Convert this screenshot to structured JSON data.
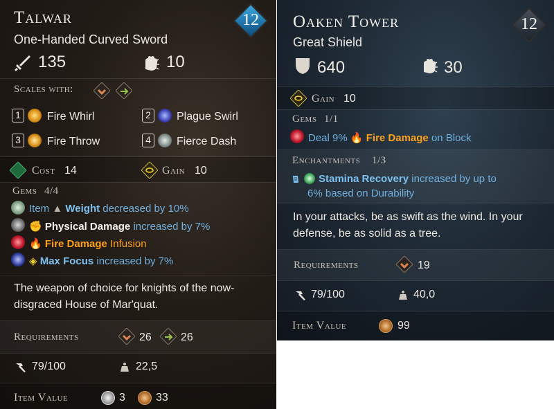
{
  "left": {
    "title": "Talwar",
    "level": "12",
    "subtitle": "One-Handed Curved Sword",
    "damage": "135",
    "stagger": "10",
    "scales_label": "Scales with:",
    "skills": [
      {
        "key": "1",
        "name": "Fire Whirl"
      },
      {
        "key": "2",
        "name": "Plague Swirl"
      },
      {
        "key": "3",
        "name": "Fire Throw"
      },
      {
        "key": "4",
        "name": "Fierce Dash"
      }
    ],
    "cost_label": "Cost",
    "cost_value": "14",
    "gain_label": "Gain",
    "gain_value": "10",
    "gems_label": "Gems",
    "gems_count": "4/4",
    "gems": [
      {
        "pre": "Item",
        "stat": "Weight",
        "post": "decreased by 10%"
      },
      {
        "pre": "",
        "stat": "Physical Damage",
        "post": "increased by 7%"
      },
      {
        "pre": "",
        "stat": "Fire Damage",
        "post": "Infusion"
      },
      {
        "pre": "",
        "stat": "Max Focus",
        "post": "increased by 7%"
      }
    ],
    "description_line1": "The weapon of choice for knights of the now-",
    "description_line2": "disgraced House of Mar'quat.",
    "requirements_label": "Requirements",
    "req_strength": "26",
    "req_agility": "26",
    "durability": "79/100",
    "weight": "22,5",
    "item_value_label": "Item Value",
    "value_silver": "3",
    "value_bronze": "33"
  },
  "right": {
    "title": "Oaken Tower",
    "level": "12",
    "subtitle": "Great Shield",
    "armor": "640",
    "stagger": "30",
    "gain_label": "Gain",
    "gain_value": "10",
    "gems_label": "Gems",
    "gems_count": "1/1",
    "gem_pre": "Deal 9%",
    "gem_stat": "Fire Damage",
    "gem_post": "on Block",
    "enchant_label": "Enchantments",
    "enchant_count": "1/3",
    "enchant_stat": "Stamina Recovery",
    "enchant_post": "increased by up to",
    "enchant_line2": "6% based on Durability",
    "description_line1": "In your attacks, be as swift as the wind. In your",
    "description_line2": "defense, be as solid as a tree.",
    "requirements_label": "Requirements",
    "req_strength": "19",
    "durability": "79/100",
    "weight": "40,0",
    "item_value_label": "Item Value",
    "value_bronze": "99"
  },
  "colors": {
    "stat_blue": "#6fb0e0",
    "fire_orange": "#ffa11a",
    "level_badge": "#1e6fa3"
  },
  "icons": [
    "sword-icon",
    "stagger-hand-icon",
    "shield-icon",
    "strength-scale-icon",
    "agility-scale-icon",
    "focus-gain-icon",
    "stamina-cost-icon",
    "durability-hammer-icon",
    "weight-icon",
    "silver-coin-icon",
    "bronze-coin-icon"
  ]
}
